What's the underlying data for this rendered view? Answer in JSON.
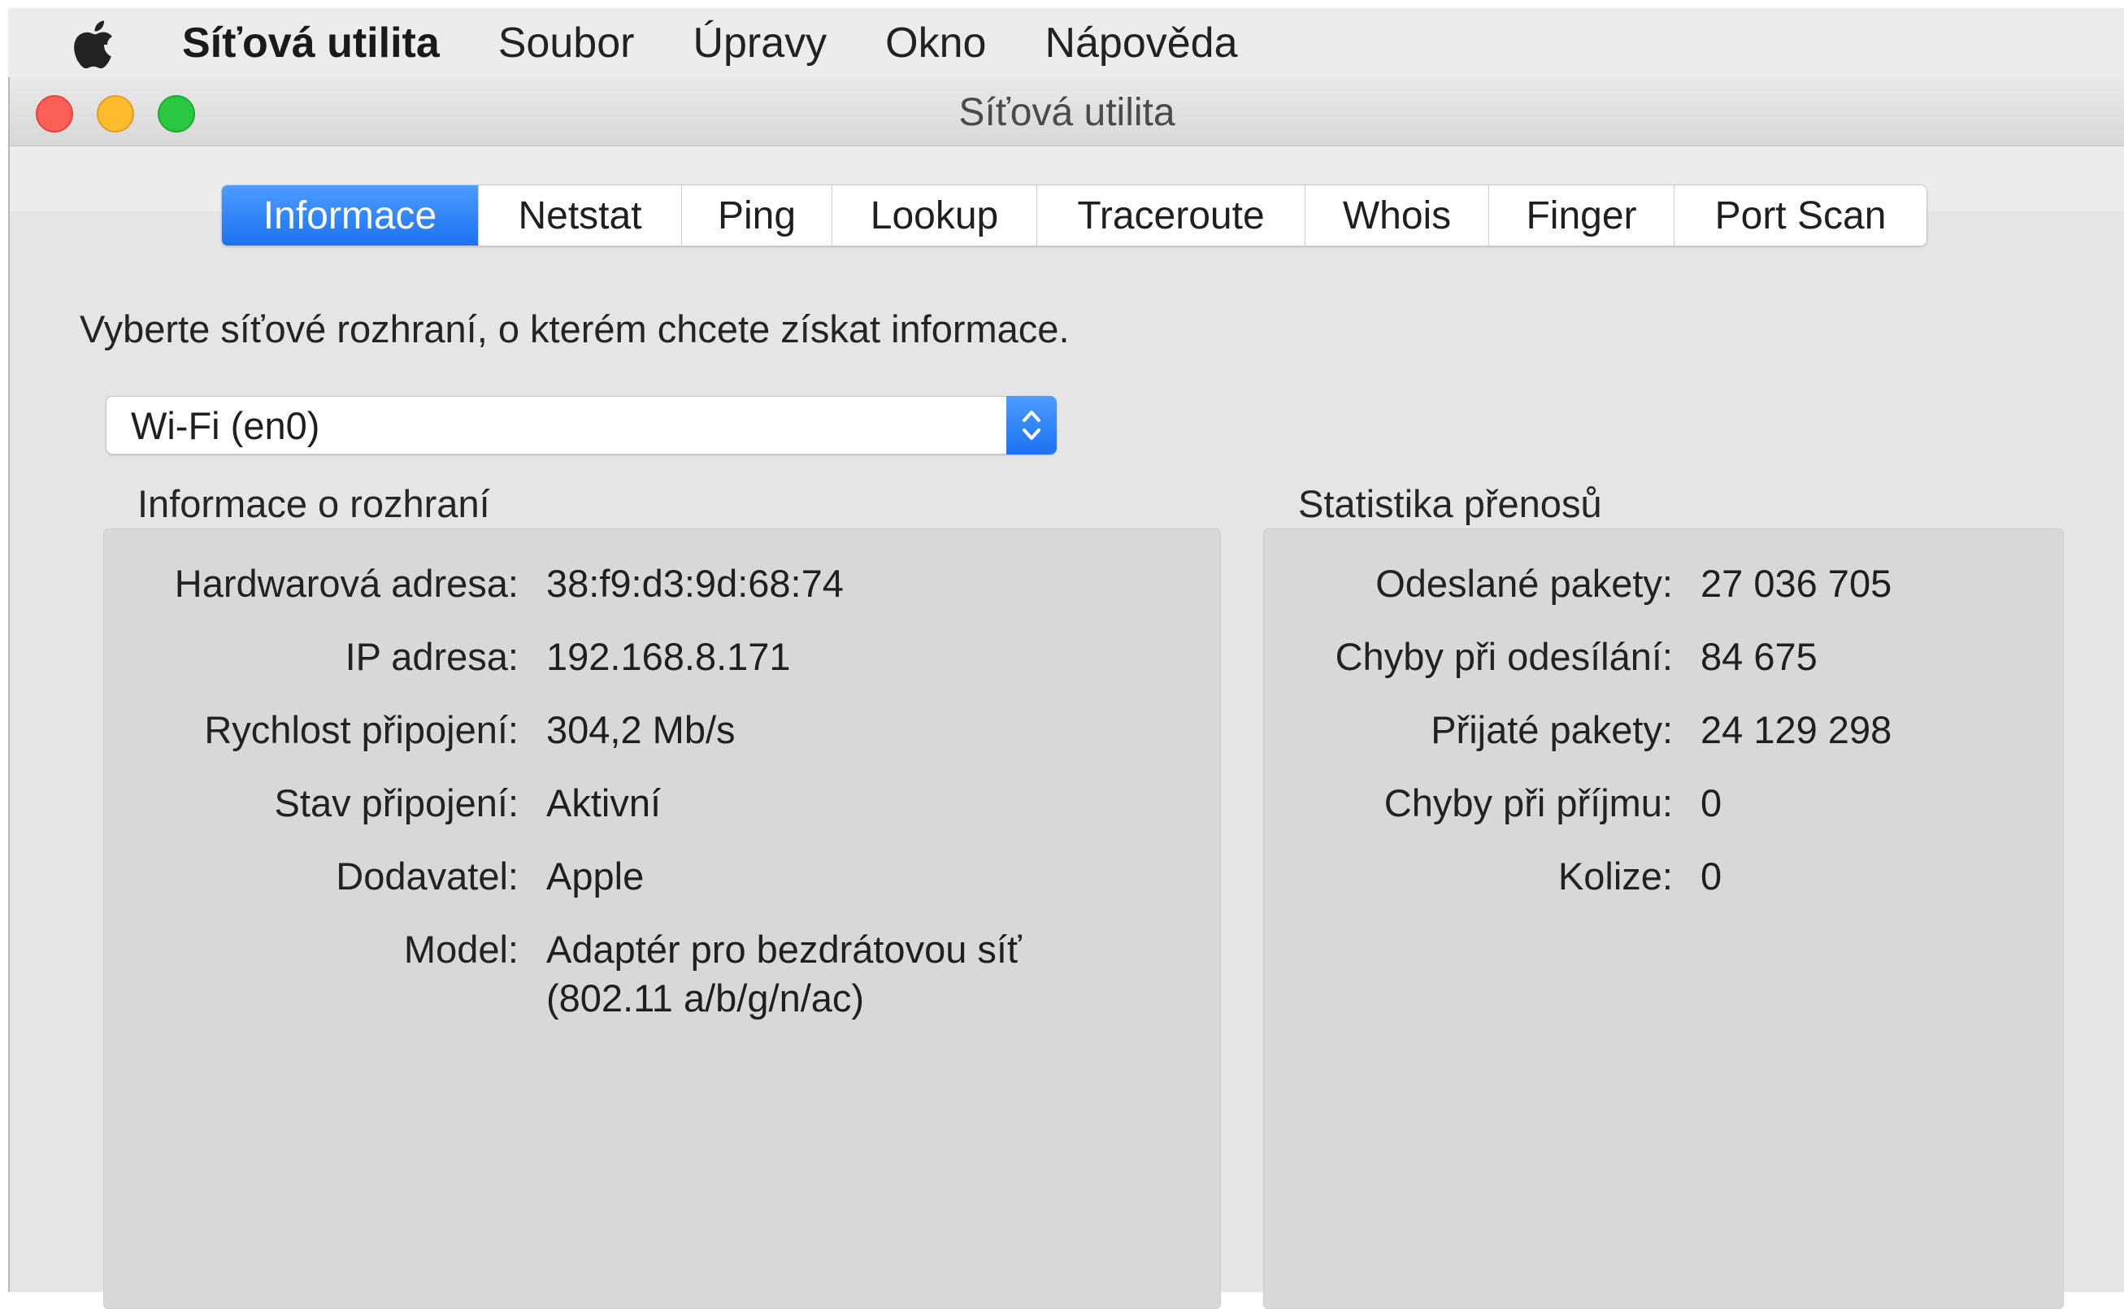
{
  "menubar": {
    "app_name": "Síťová utilita",
    "items": [
      "Soubor",
      "Úpravy",
      "Okno",
      "Nápověda"
    ]
  },
  "window": {
    "title": "Síťová utilita"
  },
  "tabs": [
    {
      "label": "Informace",
      "active": true
    },
    {
      "label": "Netstat",
      "active": false
    },
    {
      "label": "Ping",
      "active": false
    },
    {
      "label": "Lookup",
      "active": false
    },
    {
      "label": "Traceroute",
      "active": false
    },
    {
      "label": "Whois",
      "active": false
    },
    {
      "label": "Finger",
      "active": false
    },
    {
      "label": "Port Scan",
      "active": false
    }
  ],
  "prompt": "Vyberte síťové rozhraní, o kterém chcete získat informace.",
  "interface_select": {
    "value": "Wi-Fi (en0)"
  },
  "interface_info": {
    "title": "Informace o rozhraní",
    "rows": [
      {
        "label": "Hardwarová adresa:",
        "value": "38:f9:d3:9d:68:74"
      },
      {
        "label": "IP adresa:",
        "value": "192.168.8.171"
      },
      {
        "label": "Rychlost připojení:",
        "value": "304,2 Mb/s"
      },
      {
        "label": "Stav připojení:",
        "value": "Aktivní"
      },
      {
        "label": "Dodavatel:",
        "value": "Apple"
      },
      {
        "label": "Model:",
        "value": "Adaptér pro bezdrátovou síť",
        "value2": "(802.11 a/b/g/n/ac)"
      }
    ]
  },
  "transfer_stats": {
    "title": "Statistika přenosů",
    "rows": [
      {
        "label": "Odeslané pakety:",
        "value": "27 036 705"
      },
      {
        "label": "Chyby při odesílání:",
        "value": "84 675"
      },
      {
        "label": "Přijaté pakety:",
        "value": "24 129 298"
      },
      {
        "label": "Chyby při příjmu:",
        "value": "0"
      },
      {
        "label": "Kolize:",
        "value": "0"
      }
    ]
  },
  "colors": {
    "accent": "#1c72f2",
    "close": "#fc5f57",
    "minimize": "#fdbb2e",
    "zoom": "#29c840"
  }
}
